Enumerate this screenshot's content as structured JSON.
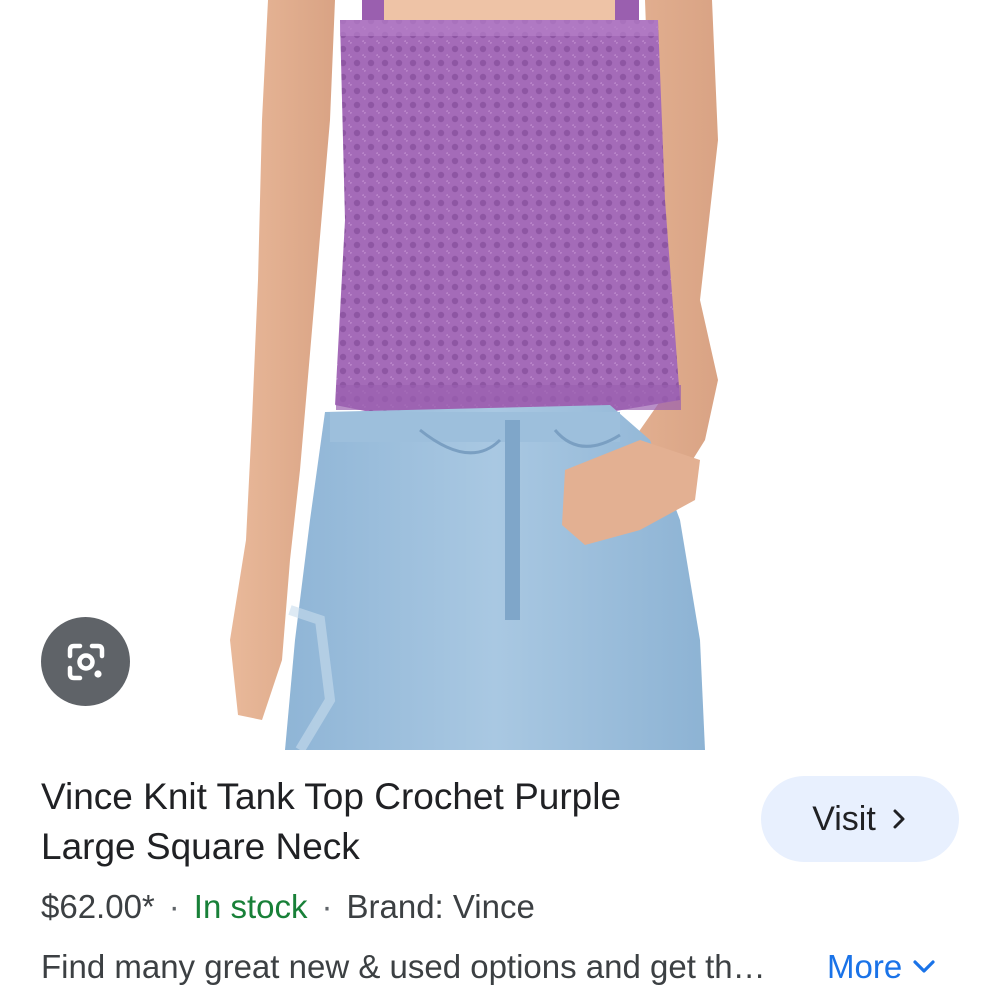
{
  "image": {
    "alt": "Vince Knit Tank Top Crochet Purple Large Square Neck"
  },
  "lens": {
    "icon": "google-lens-icon"
  },
  "product": {
    "title": "Vince Knit Tank Top Crochet Purple Large Square Neck",
    "price": "$62.00*",
    "separator": "·",
    "stock": "In stock",
    "brand": "Brand: Vince",
    "description": "Find many great new & used options and get th…"
  },
  "actions": {
    "visit_label": "Visit",
    "visit_icon": "chevron-right-icon",
    "more_label": "More",
    "more_icon": "chevron-down-icon"
  },
  "colors": {
    "accent": "#1a73e8",
    "in_stock": "#188038",
    "visit_bg": "#e8f0fe"
  }
}
